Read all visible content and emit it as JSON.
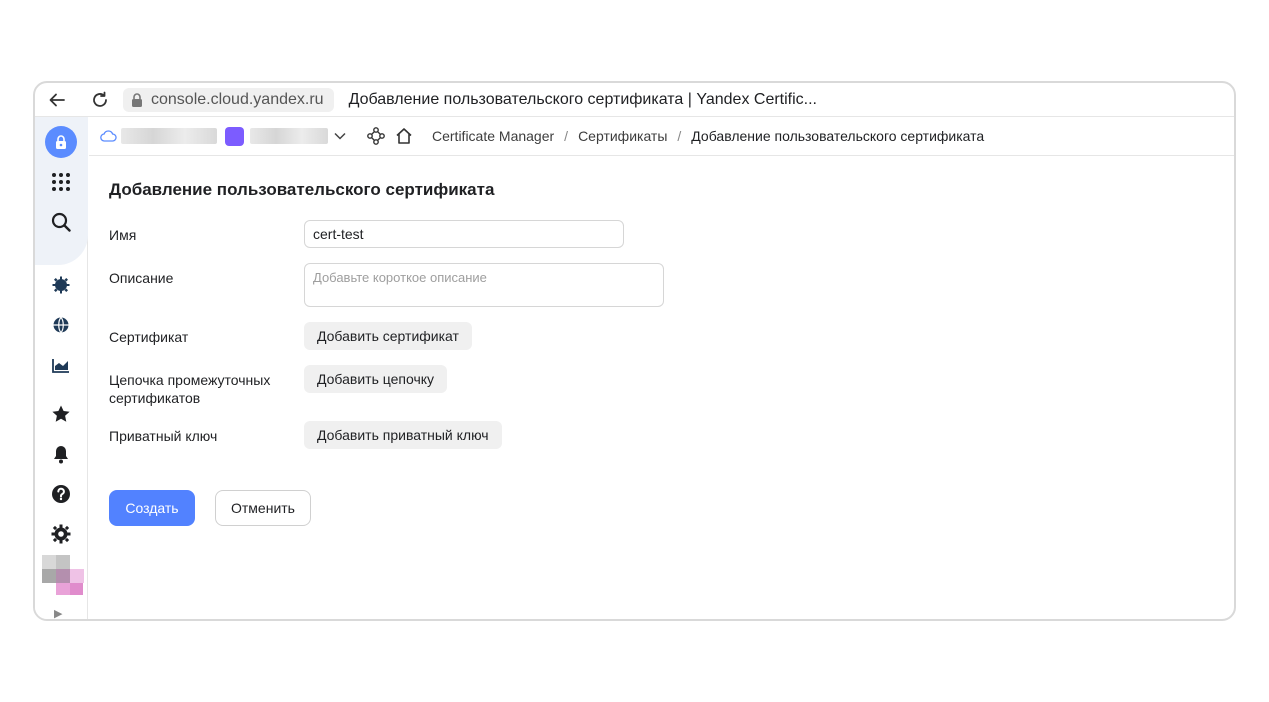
{
  "browser": {
    "url": "console.cloud.yandex.ru",
    "tab_title": "Добавление пользовательского сертификата | Yandex Certific..."
  },
  "sidebar": {
    "icons": [
      "cloud-lock-logo-icon",
      "apps-grid-icon",
      "search-icon",
      "gear-cog-icon",
      "globe-icon",
      "chart-icon",
      "star-icon",
      "bell-icon",
      "help-icon",
      "settings-icon"
    ],
    "expand_glyph": "▶"
  },
  "breadcrumbs": {
    "service": "Certificate Manager",
    "section": "Сертификаты",
    "current": "Добавление пользовательского сертификата",
    "separator": "/"
  },
  "form": {
    "title": "Добавление пользовательского сертификата",
    "name_label": "Имя",
    "name_value": "cert-test",
    "description_label": "Описание",
    "description_placeholder": "Добавьте короткое описание",
    "certificate_label": "Сертификат",
    "certificate_button": "Добавить сертификат",
    "chain_label_line1": "Цепочка промежуточных",
    "chain_label_line2": "сертификатов",
    "chain_button": "Добавить цепочку",
    "private_key_label": "Приватный ключ",
    "private_key_button": "Добавить приватный ключ",
    "create_button": "Создать",
    "cancel_button": "Отменить"
  },
  "colors": {
    "primary": "#5282ff",
    "logo": "#5b8cff",
    "folder_badge": "#7c5cff"
  }
}
